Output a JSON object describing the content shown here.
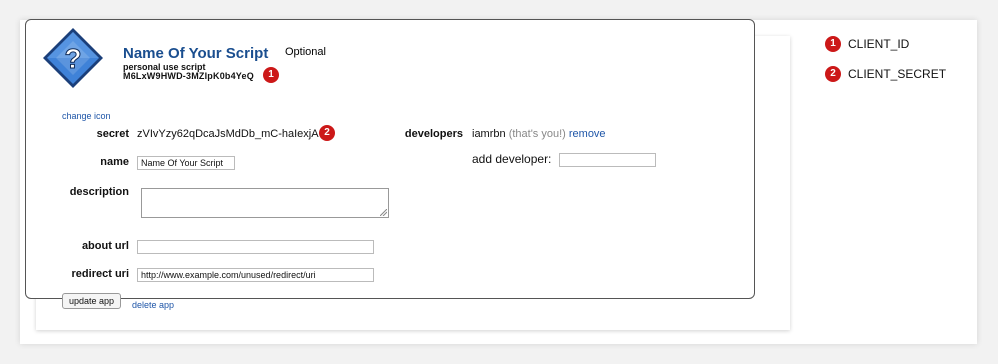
{
  "app": {
    "name": "Name Of Your Script",
    "optional_label": "Optional",
    "type_label": "personal use script",
    "client_id": "M6LxW9HWD-3MZlpK0b4YeQ",
    "change_icon_label": "change icon",
    "icon": "question-mark-diamond-icon"
  },
  "form": {
    "secret_label": "secret",
    "secret_value": "zVIvYzy62qDcaJsMdDb_mC-haIexjA",
    "name_label": "name",
    "name_value": "Name Of Your Script",
    "description_label": "description",
    "description_value": "",
    "about_url_label": "about url",
    "about_url_value": "",
    "redirect_uri_label": "redirect uri",
    "redirect_uri_value": "http://www.example.com/unused/redirect/uri",
    "update_button": "update app",
    "delete_link": "delete app"
  },
  "developers": {
    "label": "developers",
    "user": "iamrbn",
    "you_note": "(that's you!)",
    "remove_link": "remove",
    "add_label": "add developer:",
    "add_value": ""
  },
  "annotations": {
    "badge_1": "1",
    "badge_2": "2",
    "legend": [
      {
        "number": "1",
        "label": "CLIENT_ID"
      },
      {
        "number": "2",
        "label": "CLIENT_SECRET"
      }
    ],
    "badge_color": "#cc1818"
  },
  "colors": {
    "title": "#1a4e8f",
    "link": "#1f56a8",
    "icon_blue": "#2d6bc4"
  }
}
